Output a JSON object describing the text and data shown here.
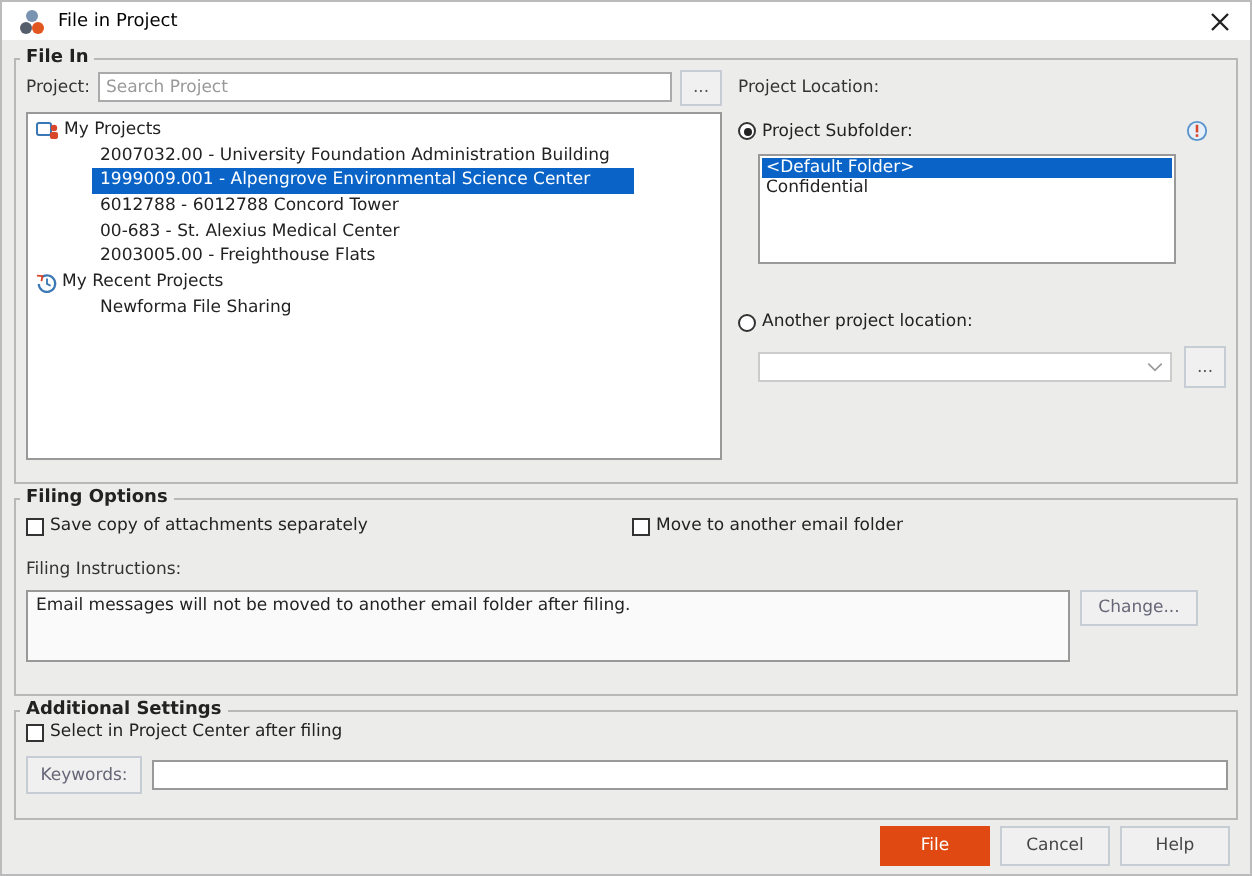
{
  "window": {
    "title": "File in Project"
  },
  "file_in": {
    "legend": "File In",
    "project_label": "Project:",
    "search": {
      "placeholder": "Search Project"
    },
    "browse_button": "...",
    "tree": [
      {
        "label": "My Projects",
        "kind": "projects",
        "children": [
          {
            "label": "2007032.00 - University Foundation Administration Building",
            "selected": false
          },
          {
            "label": "1999009.001 - Alpengrove Environmental Science Center",
            "selected": true
          },
          {
            "label": "6012788 - 6012788 Concord Tower",
            "selected": false
          },
          {
            "label": "00-683 - St. Alexius Medical Center",
            "selected": false
          },
          {
            "label": "2003005.00 - Freighthouse Flats",
            "selected": false
          }
        ]
      },
      {
        "label": "My Recent Projects",
        "kind": "recent",
        "children": [
          {
            "label": "Newforma File Sharing",
            "selected": false
          }
        ]
      }
    ],
    "location_label": "Project Location:",
    "subfolder_option": {
      "label": "Project Subfolder:",
      "selected": true
    },
    "subfolders": [
      {
        "label": "<Default Folder>",
        "selected": true
      },
      {
        "label": "Confidential",
        "selected": false
      }
    ],
    "other_option": {
      "label": "Another project location:",
      "selected": false
    },
    "location_browse_button": "..."
  },
  "filing_options": {
    "legend": "Filing Options",
    "checkboxes": [
      {
        "label": "Save copy of attachments separately",
        "checked": false
      },
      {
        "label": "Move to another email folder",
        "checked": false
      }
    ],
    "instructions_label": "Filing Instructions:",
    "instructions": "Email messages will not be moved to another email folder after filing.",
    "change_button": "Change..."
  },
  "additional_settings": {
    "legend": "Additional Settings",
    "checkboxes": [
      {
        "label": "Select in Project Center after filing",
        "checked": false
      }
    ],
    "keywords_button": "Keywords:"
  },
  "buttons": [
    {
      "label": "File",
      "kind": "primary"
    },
    {
      "label": "Cancel",
      "kind": "default"
    },
    {
      "label": "Help",
      "kind": "default"
    }
  ]
}
